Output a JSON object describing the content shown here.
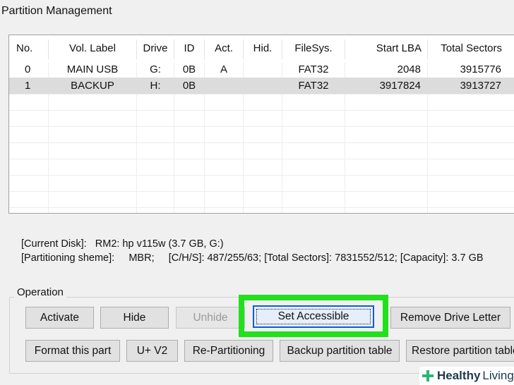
{
  "window": {
    "title": "Partition Management"
  },
  "table": {
    "columns": [
      {
        "key": "no",
        "label": "No."
      },
      {
        "key": "label",
        "label": "Vol. Label"
      },
      {
        "key": "drive",
        "label": "Drive"
      },
      {
        "key": "id",
        "label": "ID"
      },
      {
        "key": "act",
        "label": "Act."
      },
      {
        "key": "hid",
        "label": "Hid."
      },
      {
        "key": "fs",
        "label": "FileSys."
      },
      {
        "key": "start",
        "label": "Start LBA"
      },
      {
        "key": "total",
        "label": "Total Sectors"
      }
    ],
    "rows": [
      {
        "no": "0",
        "label": "MAIN USB",
        "drive": "G:",
        "id": "0B",
        "act": "A",
        "hid": "",
        "fs": "FAT32",
        "start": "2048",
        "total": "3915776"
      },
      {
        "no": "1",
        "label": "BACKUP",
        "drive": "H:",
        "id": "0B",
        "act": "",
        "hid": "",
        "fs": "FAT32",
        "start": "3917824",
        "total": "3913727"
      }
    ]
  },
  "disk_info": {
    "current_disk_label": "[Current Disk]:",
    "current_disk_value": "RM2: hp v115w (3.7 GB, G:)",
    "partitioning_label": "[Partitioning sheme]:",
    "partitioning_value": "MBR;",
    "chs_label": "[C/H/S]:",
    "chs_value": "487/255/63;",
    "sectors_label": "[Total Sectors]:",
    "sectors_value": "7831552/512;",
    "capacity_label": "[Capacity]:",
    "capacity_value": "3.7 GB"
  },
  "operation": {
    "group_label": "Operation",
    "activate": "Activate",
    "hide": "Hide",
    "unhide": "Unhide",
    "set_accessible": "Set Accessible",
    "remove_drive_letter": "Remove Drive Letter",
    "format": "Format this part",
    "uv2": "U+ V2",
    "repartition": "Re-Partitioning",
    "backup_table": "Backup partition table",
    "restore_table": "Restore partition table"
  },
  "watermark": {
    "brand_bold": "Healthy",
    "brand_light": "Living"
  },
  "colors": {
    "highlight": "#22e01c",
    "selected_row": "#dcdcdc",
    "focus_border": "#0a5fd8"
  }
}
